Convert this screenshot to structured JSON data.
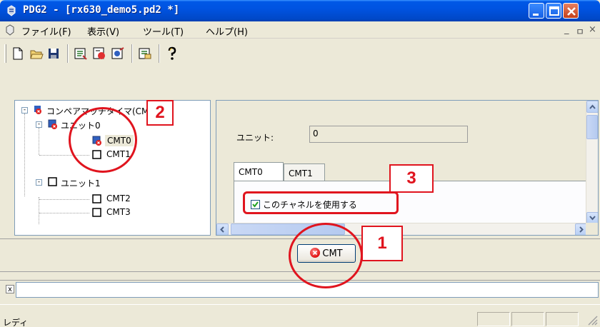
{
  "window": {
    "title": "PDG2 - [rx630_demo5.pd2 *]",
    "icon": "pdg-app-icon",
    "controls": [
      "minimize-icon",
      "maximize-icon",
      "close-icon"
    ]
  },
  "menu": {
    "items": [
      "ファイル(F)",
      "表示(V)",
      "ツール(T)",
      "ヘルプ(H)"
    ],
    "mdi_controls": [
      "_",
      "ㅁ",
      "×"
    ]
  },
  "toolbar": {
    "buttons": [
      "new-file-icon",
      "open-folder-icon",
      "save-icon",
      "generate-icon",
      "run-icon",
      "build-icon",
      "check-icon",
      "help-icon"
    ]
  },
  "tree": {
    "root": "コンペアマッチタイマ(CMT)",
    "unit0": "ユニット0",
    "cmt0": "CMT0",
    "cmt1": "CMT1",
    "unit1": "ユニット1",
    "cmt2": "CMT2",
    "cmt3": "CMT3"
  },
  "properties": {
    "unit_label": "ユニット:",
    "unit_value": "0",
    "tabs": [
      "CMT0",
      "CMT1"
    ],
    "active_tab": "CMT0",
    "use_channel_label": "このチャネルを使用する",
    "use_channel_checked": true
  },
  "action_button": {
    "label": "CMT",
    "icon": "error-icon"
  },
  "command_bar": {
    "close_glyph": "x",
    "input_value": ""
  },
  "status": {
    "text": "レディ"
  },
  "annotations": {
    "colors": {
      "callout": "#e0141e"
    },
    "labels": [
      "1",
      "2",
      "3"
    ]
  }
}
